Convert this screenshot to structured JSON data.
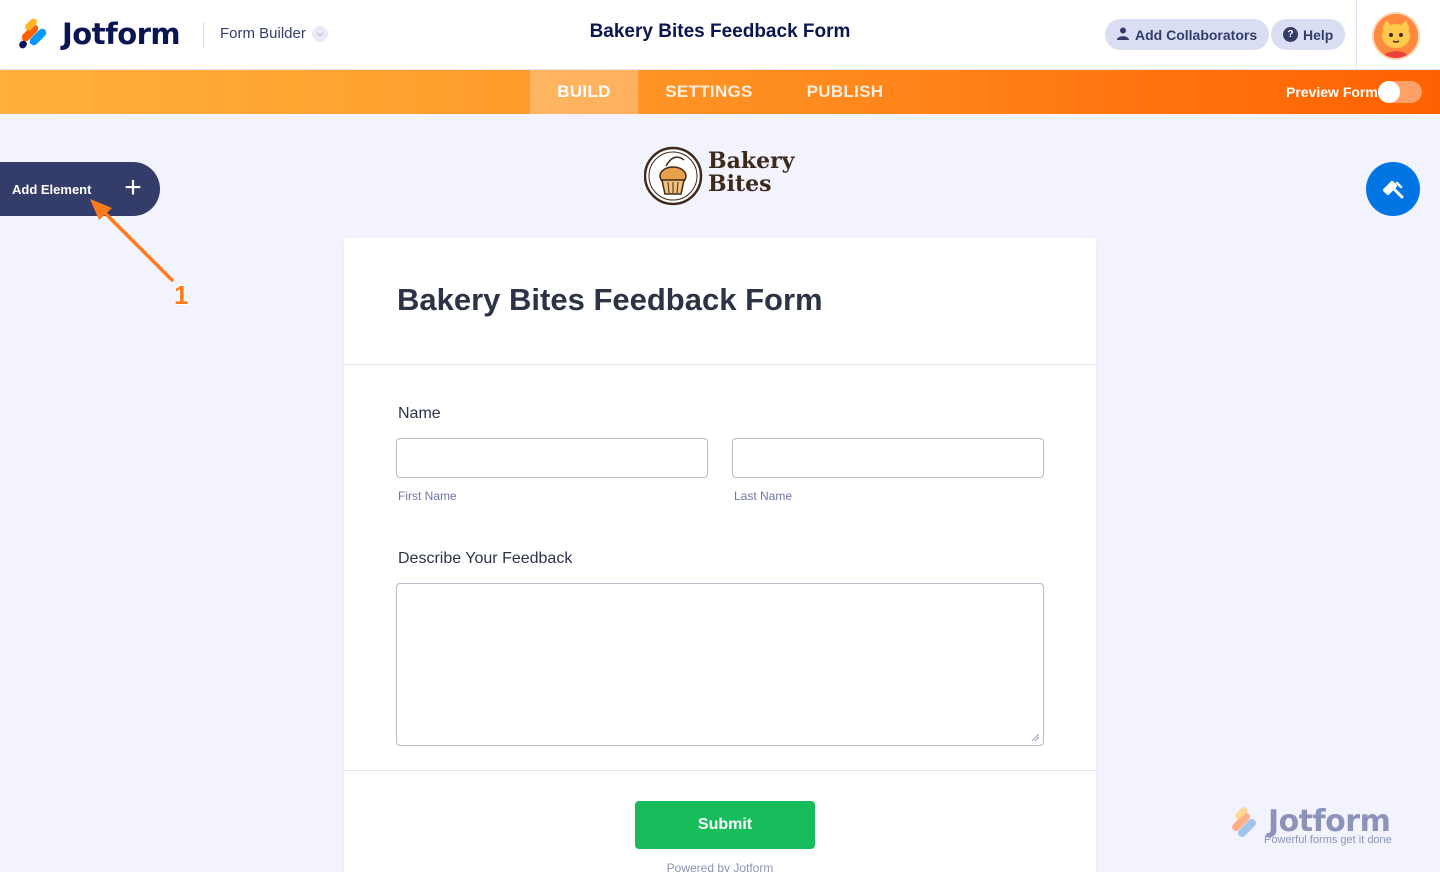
{
  "header": {
    "brand": "Jotform",
    "builder_dropdown": "Form Builder",
    "form_title": "Bakery Bites Feedback Form",
    "add_collaborators": "Add Collaborators",
    "help": "Help"
  },
  "nav": {
    "tabs": [
      {
        "label": "BUILD",
        "active": true
      },
      {
        "label": "SETTINGS",
        "active": false
      },
      {
        "label": "PUBLISH",
        "active": false
      }
    ],
    "preview_label": "Preview Form",
    "preview_on": false
  },
  "sidebar": {
    "add_element": "Add Element",
    "annotation_number": "1"
  },
  "logo": {
    "line1": "Bakery",
    "line2": "Bites"
  },
  "form": {
    "title": "Bakery Bites Feedback Form",
    "name_label": "Name",
    "first_name_sublabel": "First Name",
    "last_name_sublabel": "Last Name",
    "feedback_label": "Describe Your Feedback",
    "submit_label": "Submit",
    "powered_by": "Powered by Jotform"
  },
  "watermark": {
    "brand": "Jotform",
    "tagline": "Powerful forms get it done"
  },
  "colors": {
    "navy": "#0a1551",
    "orange": "#ff6100",
    "submit_green": "#18bd5b",
    "paint_blue": "#0075e3"
  }
}
